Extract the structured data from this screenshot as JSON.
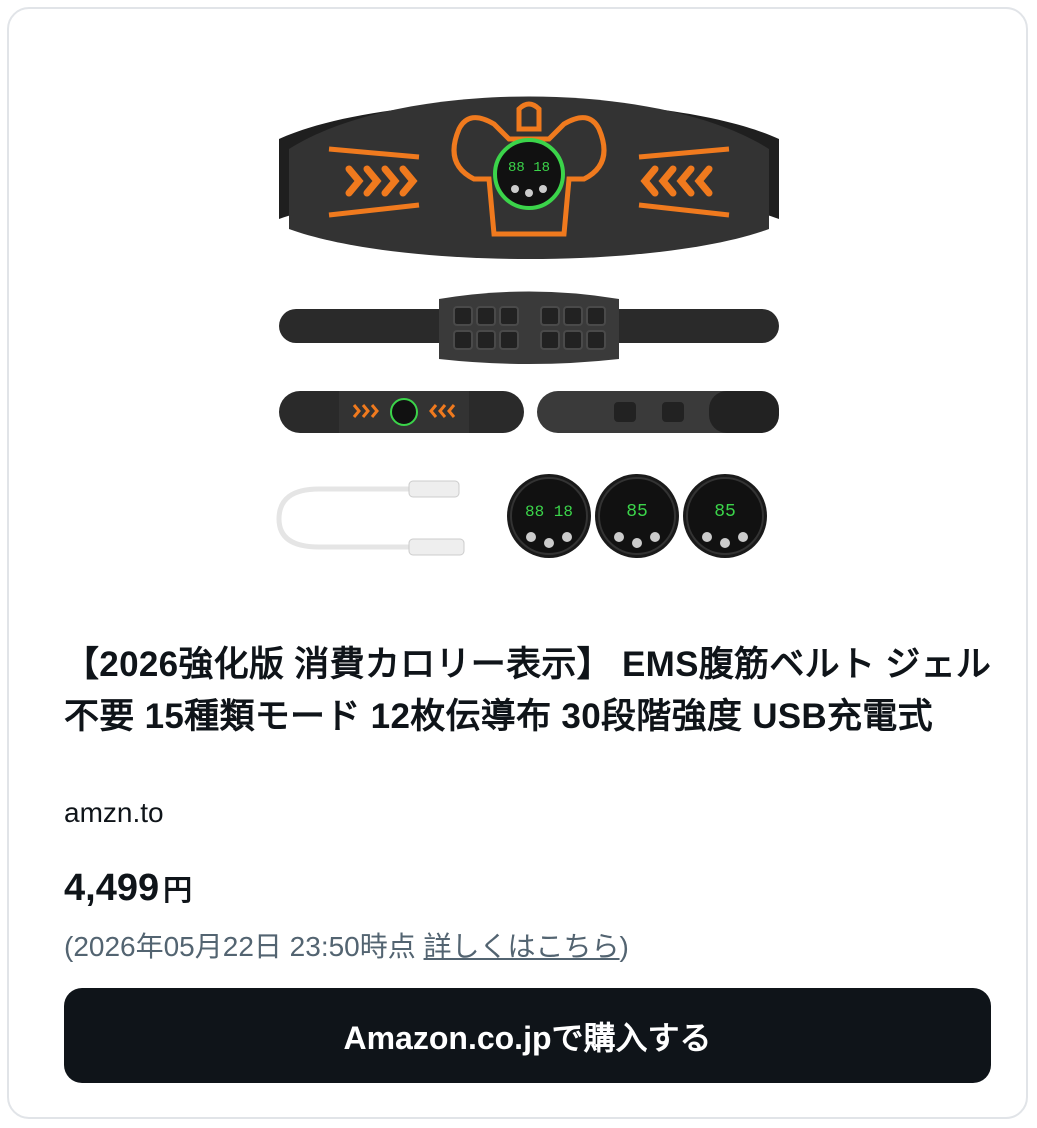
{
  "card": {
    "title": "【2026強化版 消費カロリー表示】 EMS腹筋ベルト ジェル不要 15種類モード 12枚伝導布 30段階強度 USB充電式",
    "domain": "amzn.to",
    "price_amount": "4,499",
    "price_unit": "円",
    "timestamp_prefix": "(2026年05月22日 23:50時点 ",
    "details_link": "詳しくはこちら",
    "timestamp_suffix": ")",
    "buy_button_label": "Amazon.co.jpで購入する"
  },
  "colors": {
    "belt": "#2b2b2b",
    "accent_orange": "#f07a1e",
    "display_green": "#3bd44a",
    "button": "#0f1419"
  }
}
